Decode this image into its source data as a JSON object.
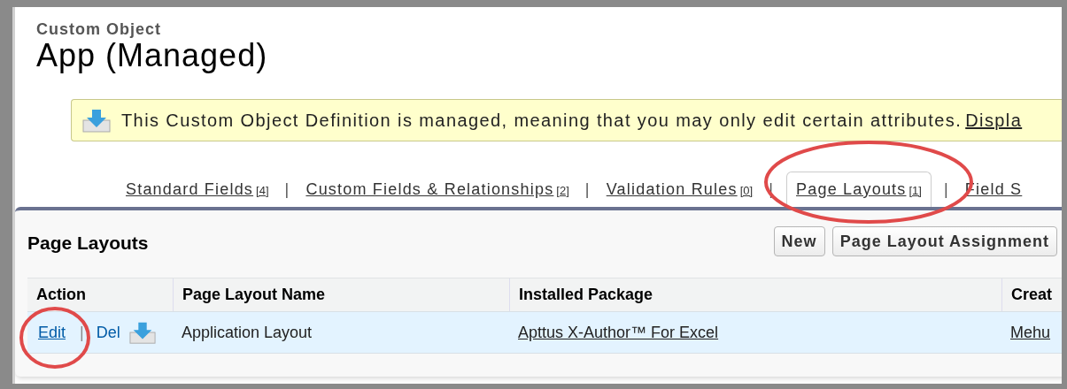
{
  "header": {
    "object_type": "Custom Object",
    "title": "App (Managed)"
  },
  "banner": {
    "message": "This Custom Object Definition is managed, meaning that you may only edit certain attributes.",
    "link": "Displa"
  },
  "tabs": [
    {
      "label": "Standard Fields",
      "count": "[4]",
      "selected": false,
      "separator": "|"
    },
    {
      "label": "Custom Fields & Relationships",
      "count": "[2]",
      "selected": false,
      "separator": "|"
    },
    {
      "label": "Validation Rules",
      "count": "[0]",
      "selected": false,
      "separator": "|"
    },
    {
      "label": "Page Layouts",
      "count": "[1]",
      "selected": true,
      "separator": "|"
    },
    {
      "label": "Field S",
      "selected": false
    }
  ],
  "panel": {
    "title": "Page Layouts",
    "buttons": [
      "New",
      "Page Layout Assignment"
    ],
    "table": {
      "columns": [
        "Action",
        "Page Layout Name",
        "Installed Package",
        "Creat"
      ],
      "rows": [
        {
          "edit": "Edit",
          "separator": "|",
          "delete": "Del",
          "name": "Application Layout",
          "installed_package": "Apttus X-Author™ For Excel",
          "column_4": "Mehu"
        }
      ]
    }
  }
}
